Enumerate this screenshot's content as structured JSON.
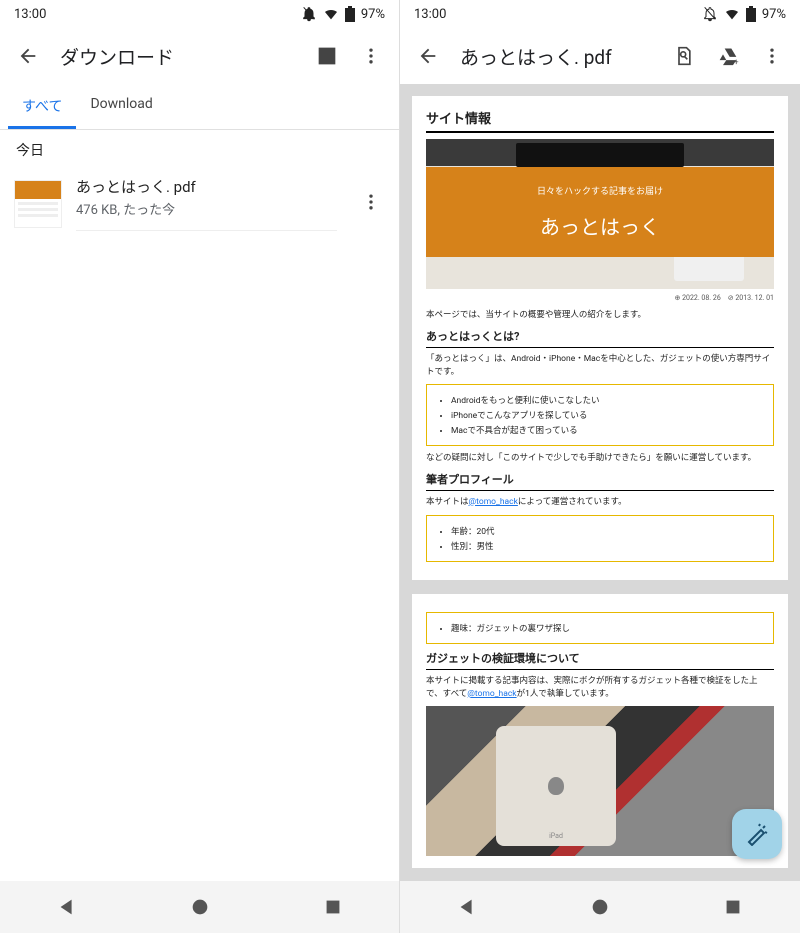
{
  "status": {
    "time": "13:00",
    "battery": "97%"
  },
  "left": {
    "title": "ダウンロード",
    "tabs": {
      "all": "すべて",
      "download": "Download"
    },
    "section": "今日",
    "file": {
      "name": "あっとはっく. pdf",
      "meta": "476 KB, たった今"
    }
  },
  "right": {
    "title": "あっとはっく. pdf",
    "page1": {
      "header": "サイト情報",
      "banner_sub": "日々をハックする記事をお届け",
      "banner_title": "あっとはっく",
      "dates": "⊕ 2022. 08. 26　⊘ 2013. 12. 01",
      "lead": "本ページでは、当サイトの概要や管理人の紹介をします。",
      "h2a": "あっとはっくとは?",
      "p1": "「あっとはっく」は、Android・iPhone・Macを中心とした、ガジェットの使い方専門サイトです。",
      "b1a": "Androidをもっと便利に使いこなしたい",
      "b1b": "iPhoneでこんなアプリを探している",
      "b1c": "Macで不具合が起きて困っている",
      "p2": "などの疑問に対し「このサイトで少しでも手助けできたら」を願いに運営しています。",
      "h2b": "筆者プロフィール",
      "p3a": "本サイトは",
      "p3link": "@tomo_hack",
      "p3b": "によって運営されています。",
      "b2a": "年齢：20代",
      "b2b": "性別：男性"
    },
    "page2": {
      "b1": "趣味：ガジェットの裏ワザ探し",
      "h2": "ガジェットの検証環境について",
      "p1a": "本サイトに掲載する記事内容は、実際にボクが所有するガジェット各種で検証をした上で、すべて",
      "p1link": "@tomo_hack",
      "p1b": "が1人で執筆しています。"
    }
  }
}
